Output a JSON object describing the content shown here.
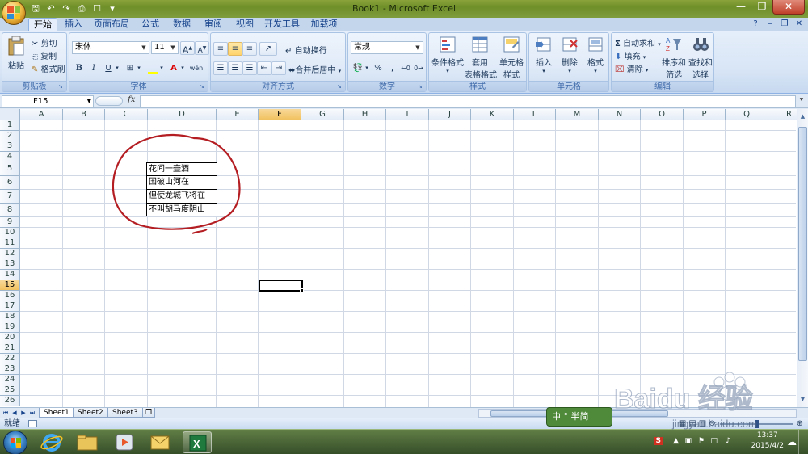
{
  "window": {
    "title": "Book1 - Microsoft Excel"
  },
  "qat": {
    "save_icon": "save-icon",
    "undo_icon": "undo-icon",
    "redo_icon": "redo-icon"
  },
  "tabs": [
    {
      "label": "开始",
      "active": true
    },
    {
      "label": "插入"
    },
    {
      "label": "页面布局"
    },
    {
      "label": "公式"
    },
    {
      "label": "数据"
    },
    {
      "label": "审阅"
    },
    {
      "label": "视图"
    },
    {
      "label": "开发工具"
    },
    {
      "label": "加载项"
    }
  ],
  "ribbon": {
    "clipboard": {
      "title": "剪贴板",
      "paste": "粘贴",
      "cut": "剪切",
      "copy": "复制",
      "format_painter": "格式刷"
    },
    "font": {
      "title": "字体",
      "font_name": "宋体",
      "font_size": "11",
      "bold": "B",
      "italic": "I",
      "underline": "U",
      "grow": "A",
      "shrink": "A",
      "font_color_letter": "A",
      "wen": "wén"
    },
    "alignment": {
      "title": "对齐方式",
      "wrap_text": "自动换行",
      "merge_center": "合并后居中"
    },
    "number": {
      "title": "数字",
      "format": "常规",
      "percent": "%",
      "comma": ","
    },
    "styles": {
      "title": "样式",
      "conditional": "条件格式",
      "table_format_1": "套用",
      "table_format_2": "表格格式",
      "cell_styles_1": "单元格",
      "cell_styles_2": "样式"
    },
    "cells": {
      "title": "单元格",
      "insert": "插入",
      "delete": "删除",
      "format": "格式"
    },
    "editing": {
      "title": "编辑",
      "autosum": "自动求和",
      "fill": "填充",
      "clear": "清除",
      "sort_1": "排序和",
      "sort_2": "筛选",
      "find_1": "查找和",
      "find_2": "选择"
    }
  },
  "formula_bar": {
    "name_box": "F15",
    "fx": "fx",
    "value": ""
  },
  "columns": [
    "A",
    "B",
    "C",
    "D",
    "E",
    "F",
    "G",
    "H",
    "I",
    "J",
    "K",
    "L",
    "M",
    "N",
    "O",
    "P",
    "Q",
    "R"
  ],
  "rows": [
    "1",
    "2",
    "3",
    "4",
    "5",
    "6",
    "7",
    "8",
    "9",
    "10",
    "11",
    "12",
    "13",
    "14",
    "15",
    "16",
    "17",
    "18",
    "19",
    "20",
    "21",
    "22",
    "23",
    "24",
    "25",
    "26"
  ],
  "cells": {
    "D5": "花间一壶酒",
    "D6": "国破山河在",
    "D7": "但使龙城飞将在",
    "D8": "不叫胡马度阴山"
  },
  "active_cell": "F15",
  "sheet_tabs": [
    {
      "label": "Sheet1",
      "active": true
    },
    {
      "label": "Sheet2"
    },
    {
      "label": "Sheet3"
    }
  ],
  "status": {
    "ready": "就绪"
  },
  "taskbar": {
    "time": "13:37",
    "date": "2015/4/2",
    "ime": "中",
    "ime_extra": "半简"
  },
  "watermark": {
    "text": "jingyan.baidu.com"
  },
  "colors": {
    "annotation_circle": "#b41e23",
    "selected_header": "#f1c15f",
    "ribbon_bg": "#dfe9f5"
  }
}
